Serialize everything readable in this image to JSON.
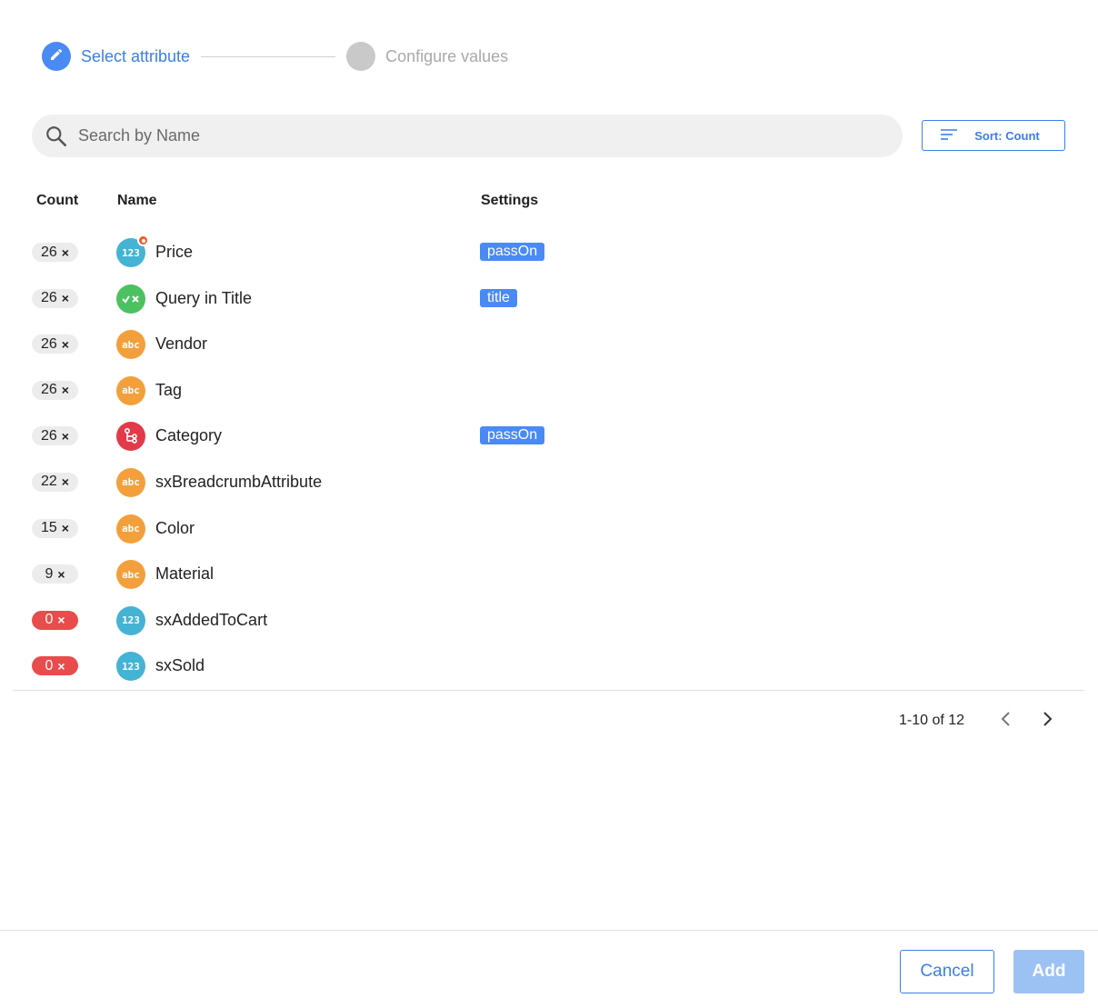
{
  "stepper": {
    "steps": [
      {
        "label": "Select attribute",
        "state": "active",
        "icon": "pencil-icon"
      },
      {
        "label": "Configure values",
        "state": "inactive"
      }
    ]
  },
  "search": {
    "placeholder": "Search by Name",
    "value": ""
  },
  "sort": {
    "label": "Sort: Count",
    "icon": "sort-icon"
  },
  "table": {
    "headers": {
      "count": "Count",
      "name": "Name",
      "settings": "Settings"
    },
    "rows": [
      {
        "count": "26",
        "name": "Price",
        "type": "number",
        "icon_text": "123",
        "pinned": true,
        "setting": "passOn"
      },
      {
        "count": "26",
        "name": "Query in Title",
        "type": "boolean",
        "icon_text": "",
        "pinned": false,
        "setting": "title"
      },
      {
        "count": "26",
        "name": "Vendor",
        "type": "string",
        "icon_text": "abc",
        "pinned": false,
        "setting": ""
      },
      {
        "count": "26",
        "name": "Tag",
        "type": "string",
        "icon_text": "abc",
        "pinned": false,
        "setting": ""
      },
      {
        "count": "26",
        "name": "Category",
        "type": "tree",
        "icon_text": "",
        "pinned": false,
        "setting": "passOn"
      },
      {
        "count": "22",
        "name": "sxBreadcrumbAttribute",
        "type": "string",
        "icon_text": "abc",
        "pinned": false,
        "setting": ""
      },
      {
        "count": "15",
        "name": "Color",
        "type": "string",
        "icon_text": "abc",
        "pinned": false,
        "setting": ""
      },
      {
        "count": "9",
        "name": "Material",
        "type": "string",
        "icon_text": "abc",
        "pinned": false,
        "setting": ""
      },
      {
        "count": "0",
        "name": "sxAddedToCart",
        "type": "number",
        "icon_text": "123",
        "pinned": false,
        "setting": ""
      },
      {
        "count": "0",
        "name": "sxSold",
        "type": "number",
        "icon_text": "123",
        "pinned": false,
        "setting": ""
      }
    ],
    "count_suffix": "×"
  },
  "pagination": {
    "text": "1-10 of 12"
  },
  "footer": {
    "cancel_label": "Cancel",
    "add_label": "Add"
  },
  "colors": {
    "accent": "#4a8af4",
    "number": "#45b3d3",
    "boolean": "#4cc160",
    "string": "#f3a03c",
    "tree": "#e23a4a",
    "zero_count": "#e84c4c",
    "pin": "#e8602c"
  }
}
